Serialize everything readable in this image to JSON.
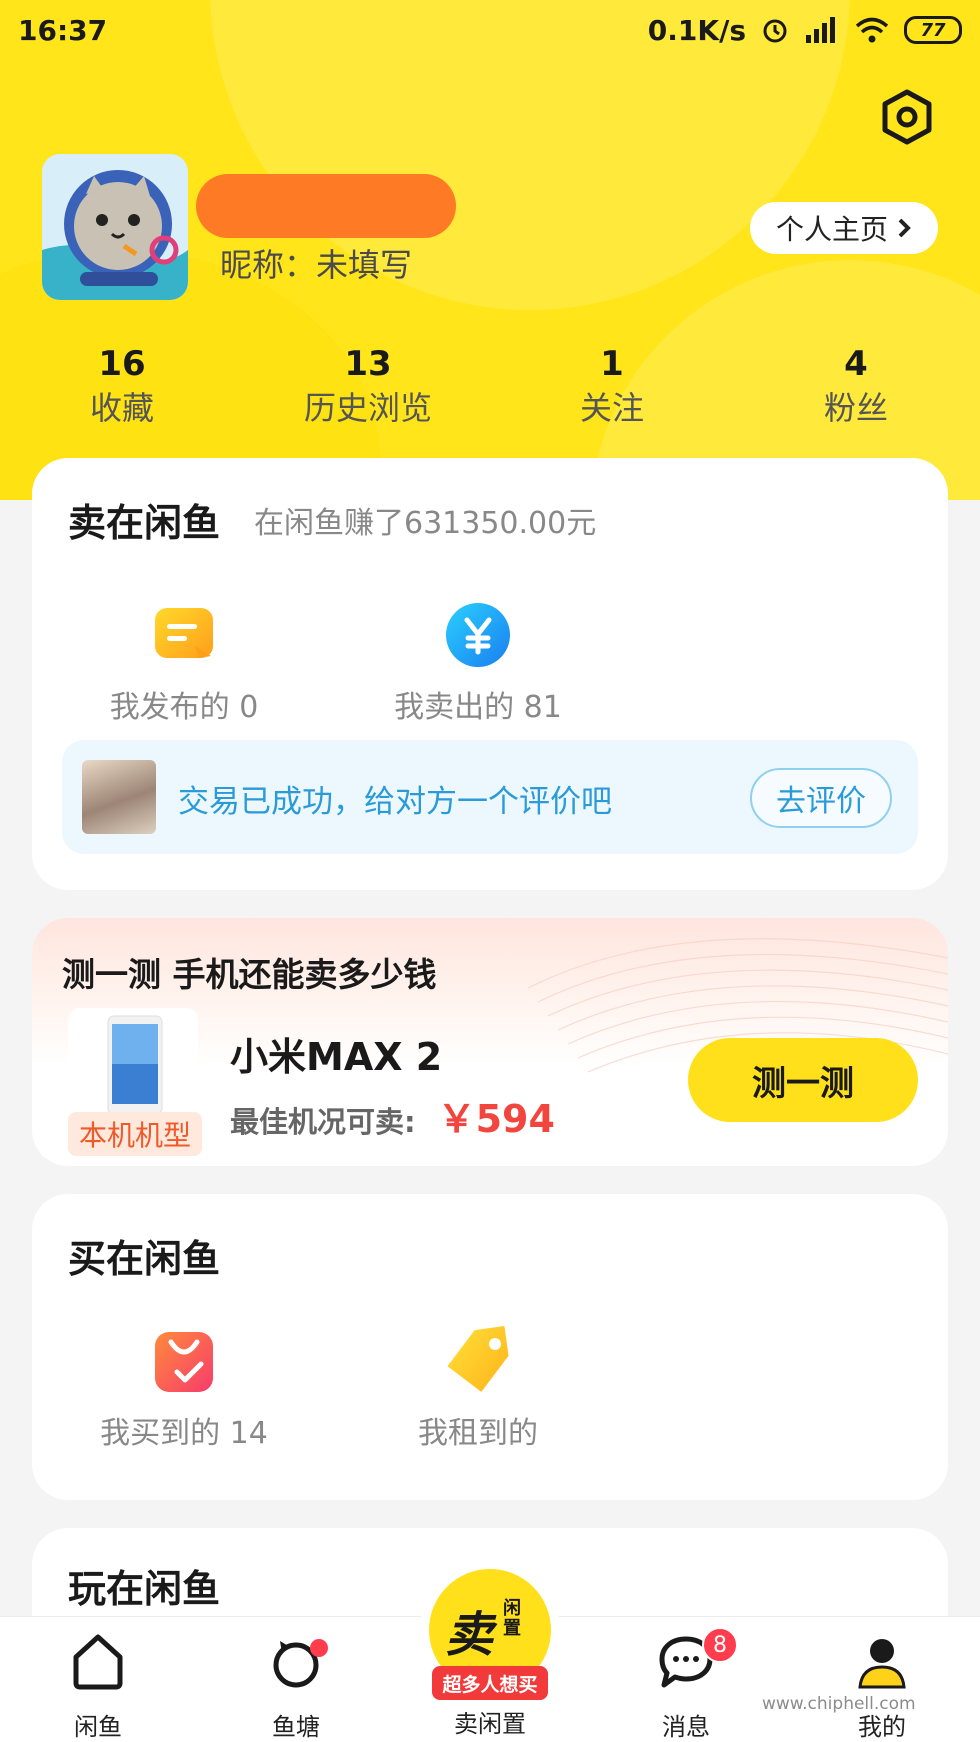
{
  "status_bar": {
    "time": "16:37",
    "speed": "0.1K/s",
    "battery": "77"
  },
  "profile": {
    "nickname": "昵称：未填写",
    "homepage_label": "个人主页"
  },
  "stats": [
    {
      "value": "16",
      "label": "收藏"
    },
    {
      "value": "13",
      "label": "历史浏览"
    },
    {
      "value": "1",
      "label": "关注"
    },
    {
      "value": "4",
      "label": "粉丝"
    }
  ],
  "sell": {
    "title": "卖在闲鱼",
    "earned": "在闲鱼赚了631350.00元",
    "published": "我发布的 0",
    "sold": "我卖出的 81",
    "review_text": "交易已成功，给对方一个评价吧",
    "review_button": "去评价"
  },
  "phone_test": {
    "title": "测一测 手机还能卖多少钱",
    "model": "小米MAX 2",
    "badge": "本机机型",
    "best_label": "最佳机况可卖:",
    "best_price": "￥594",
    "button": "测一测"
  },
  "buy": {
    "title": "买在闲鱼",
    "bought": "我买到的 14",
    "rented": "我租到的"
  },
  "play": {
    "title": "玩在闲鱼"
  },
  "tabs": {
    "home": "闲鱼",
    "pond": "鱼塘",
    "sell": "卖闲置",
    "sell_main": "卖",
    "sell_small": "闲置",
    "sell_ribbon": "超多人想买",
    "messages": "消息",
    "messages_badge": "8",
    "mine": "我的"
  },
  "watermark": "www.chiphell.com",
  "colors": {
    "brand_yellow": "#ffe51a",
    "review_blue": "#2a9ad8",
    "price_red": "#f2453d",
    "badge_red": "#ff3d4d"
  },
  "icons": [
    "settings-hex-icon",
    "chevron-right-icon",
    "publish-note-icon",
    "yuan-coin-icon",
    "shopping-bag-check-icon",
    "tag-icon",
    "home-icon",
    "pond-icon",
    "message-bubble-icon",
    "user-icon"
  ]
}
